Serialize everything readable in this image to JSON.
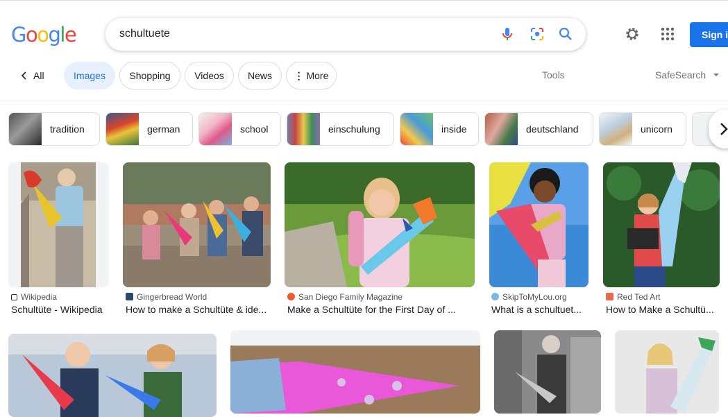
{
  "header": {
    "logo": [
      "G",
      "o",
      "o",
      "g",
      "l",
      "e"
    ],
    "logo_colors": [
      "#4285f4",
      "#ea4335",
      "#fbbc05",
      "#4285f4",
      "#34a853",
      "#ea4335"
    ],
    "query": "schultuete",
    "signin_label": "Sign in"
  },
  "tabs": {
    "all": "All",
    "items": [
      "Images",
      "Shopping",
      "Videos",
      "News",
      "More"
    ],
    "tools": "Tools",
    "safesearch": "SafeSearch"
  },
  "chips": [
    "tradition",
    "german",
    "school",
    "einschulung",
    "inside",
    "deutschland",
    "unicorn"
  ],
  "results": [
    {
      "source": "Wikipedia",
      "title": "Schultüte - Wikipedia"
    },
    {
      "source": "Gingerbread World",
      "title": "How to make a Schultüte & ide..."
    },
    {
      "source": "San Diego Family Magazine",
      "title": "Make a Schultüte for the First Day of ..."
    },
    {
      "source": "SkipToMyLou.org",
      "title": "What is a schultuet..."
    },
    {
      "source": "Red Ted Art",
      "title": "How to Make a Schultü..."
    }
  ],
  "colors": {
    "accent": "#1a73e8",
    "active_tab_bg": "#e8f0fe"
  }
}
